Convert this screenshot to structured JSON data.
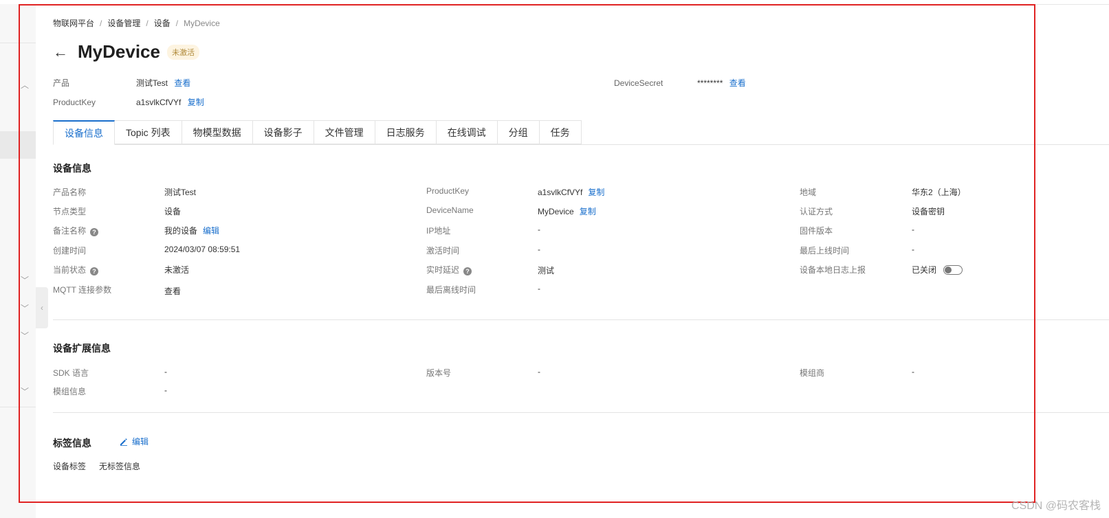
{
  "breadcrumb": [
    "物联网平台",
    "设备管理",
    "设备",
    "MyDevice"
  ],
  "device": {
    "title": "MyDevice",
    "status_badge": "未激活"
  },
  "header_meta": {
    "product_label": "产品",
    "product_value": "测试Test",
    "product_link": "查看",
    "productkey_label": "ProductKey",
    "productkey_value": "a1svlkCfVYf",
    "productkey_link": "复制",
    "secret_label": "DeviceSecret",
    "secret_value": "********",
    "secret_link": "查看"
  },
  "tabs": [
    "设备信息",
    "Topic 列表",
    "物模型数据",
    "设备影子",
    "文件管理",
    "日志服务",
    "在线调试",
    "分组",
    "任务"
  ],
  "device_info": {
    "section_title": "设备信息",
    "rows": [
      {
        "label": "产品名称",
        "value": "测试Test"
      },
      {
        "label": "节点类型",
        "value": "设备"
      },
      {
        "label": "备注名称",
        "value": "我的设备",
        "link": "编辑"
      },
      {
        "label": "创建时间",
        "value": "2024/03/07 08:59:51"
      },
      {
        "label": "当前状态",
        "value": "未激活"
      },
      {
        "label": "MQTT 连接参数",
        "link": "查看"
      },
      {
        "label": "ProductKey",
        "value": "a1svlkCfVYf",
        "link": "复制"
      },
      {
        "label": "DeviceName",
        "value": "MyDevice",
        "link": "复制"
      },
      {
        "label": "IP地址",
        "value": "-"
      },
      {
        "label": "激活时间",
        "value": "-"
      },
      {
        "label": "实时延迟",
        "link": "测试"
      },
      {
        "label": "最后离线时间",
        "value": "-"
      },
      {
        "label": "地域",
        "value": "华东2（上海）"
      },
      {
        "label": "认证方式",
        "value": "设备密钥"
      },
      {
        "label": "固件版本",
        "value": "-"
      },
      {
        "label": "最后上线时间",
        "value": "-"
      },
      {
        "label": "设备本地日志上报",
        "value": "已关闭"
      }
    ]
  },
  "ext_info": {
    "section_title": "设备扩展信息",
    "rows": [
      {
        "label": "SDK 语言",
        "value": "-"
      },
      {
        "label": "模组信息",
        "value": "-"
      },
      {
        "label": "版本号",
        "value": "-"
      },
      {
        "label": "模组商",
        "value": "-"
      }
    ]
  },
  "tag_info": {
    "section_title": "标签信息",
    "edit_label": "编辑",
    "tag_label": "设备标签",
    "tag_value": "无标签信息"
  },
  "watermark": "CSDN @码农客栈",
  "colors": {
    "link": "#1a6fcc",
    "frame": "#e02222",
    "badge_bg": "#fdf4e1"
  }
}
